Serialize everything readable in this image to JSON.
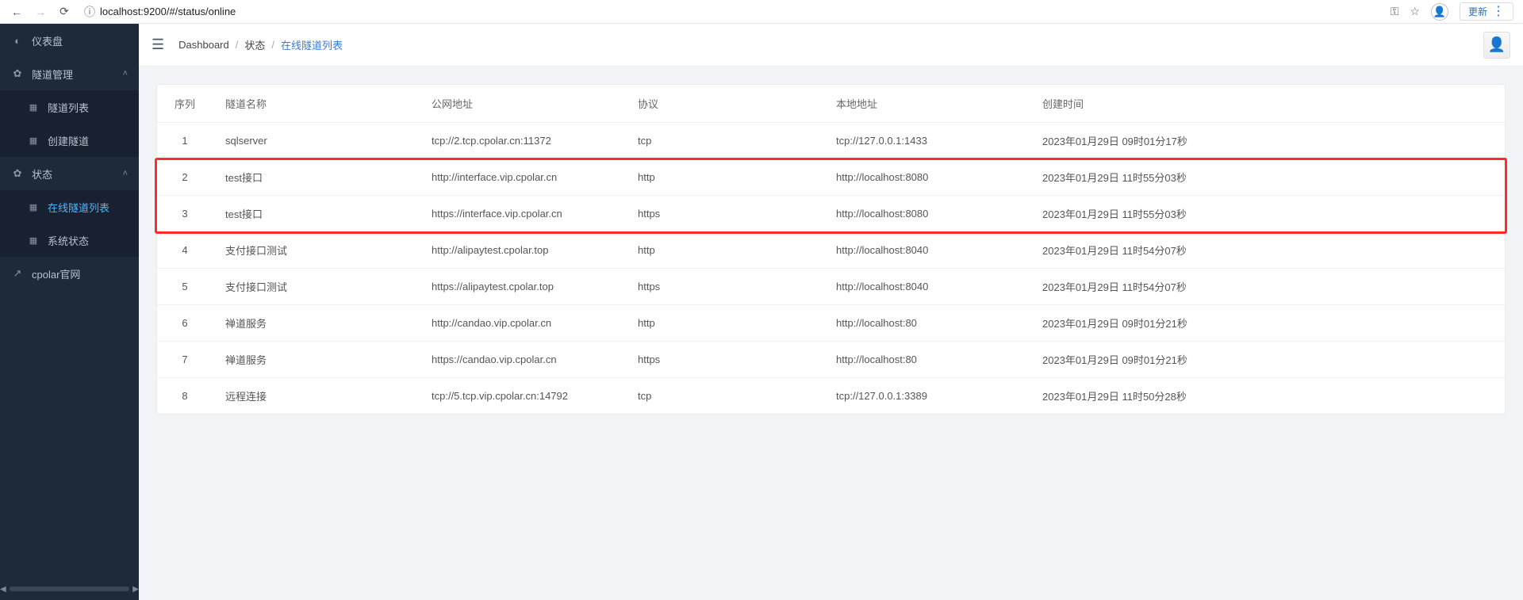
{
  "browser": {
    "url": "localhost:9200/#/status/online",
    "update_label": "更新"
  },
  "sidebar": {
    "items": [
      {
        "icon": "◐",
        "label": "仪表盘"
      },
      {
        "icon": "✿",
        "label": "隧道管理",
        "chev": "˄"
      },
      {
        "icon": "▦",
        "label": "隧道列表",
        "sub": true
      },
      {
        "icon": "▦",
        "label": "创建隧道",
        "sub": true
      },
      {
        "icon": "✿",
        "label": "状态",
        "chev": "˄"
      },
      {
        "icon": "▦",
        "label": "在线隧道列表",
        "sub": true,
        "active": true
      },
      {
        "icon": "▦",
        "label": "系统状态",
        "sub": true
      },
      {
        "icon": "↗",
        "label": "cpolar官网"
      }
    ]
  },
  "breadcrumb": {
    "a": "Dashboard",
    "b": "状态",
    "c": "在线隧道列表"
  },
  "table": {
    "headers": {
      "idx": "序列",
      "name": "隧道名称",
      "url": "公网地址",
      "proto": "协议",
      "local": "本地地址",
      "time": "创建时间"
    },
    "rows": [
      {
        "idx": "1",
        "name": "sqlserver",
        "url": "tcp://2.tcp.cpolar.cn:11372",
        "proto": "tcp",
        "local": "tcp://127.0.0.1:1433",
        "time": "2023年01月29日 09时01分17秒",
        "hl": false
      },
      {
        "idx": "2",
        "name": "test接口",
        "url": "http://interface.vip.cpolar.cn",
        "proto": "http",
        "local": "http://localhost:8080",
        "time": "2023年01月29日 11时55分03秒",
        "hl": true
      },
      {
        "idx": "3",
        "name": "test接口",
        "url": "https://interface.vip.cpolar.cn",
        "proto": "https",
        "local": "http://localhost:8080",
        "time": "2023年01月29日 11时55分03秒",
        "hl": true
      },
      {
        "idx": "4",
        "name": "支付接口测试",
        "url": "http://alipaytest.cpolar.top",
        "proto": "http",
        "local": "http://localhost:8040",
        "time": "2023年01月29日 11时54分07秒",
        "hl": false
      },
      {
        "idx": "5",
        "name": "支付接口测试",
        "url": "https://alipaytest.cpolar.top",
        "proto": "https",
        "local": "http://localhost:8040",
        "time": "2023年01月29日 11时54分07秒",
        "hl": false
      },
      {
        "idx": "6",
        "name": "禅道服务",
        "url": "http://candao.vip.cpolar.cn",
        "proto": "http",
        "local": "http://localhost:80",
        "time": "2023年01月29日 09时01分21秒",
        "hl": false
      },
      {
        "idx": "7",
        "name": "禅道服务",
        "url": "https://candao.vip.cpolar.cn",
        "proto": "https",
        "local": "http://localhost:80",
        "time": "2023年01月29日 09时01分21秒",
        "hl": false
      },
      {
        "idx": "8",
        "name": "远程连接",
        "url": "tcp://5.tcp.vip.cpolar.cn:14792",
        "proto": "tcp",
        "local": "tcp://127.0.0.1:3389",
        "time": "2023年01月29日 11时50分28秒",
        "hl": false
      }
    ]
  }
}
